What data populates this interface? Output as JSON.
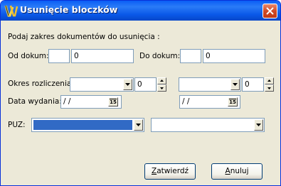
{
  "window": {
    "title": "Usunięcie bloczków",
    "app_icon": "app-logo-icon",
    "close_icon": "close-icon"
  },
  "form": {
    "instruction": "Podaj zakres dokumentów do usunięcia :",
    "from_label": "Od dokum:",
    "from_prefix_value": "",
    "from_number_value": "0",
    "to_label": "Do dokum:",
    "to_prefix_value": "",
    "to_number_value": "0",
    "period_label": "Okres rozliczenia:",
    "period_left_value": "",
    "period_left_spin_value": "0",
    "period_right_value": "",
    "period_right_spin_value": "0",
    "issue_label": "Data wydania:",
    "issue_date_left": " / /",
    "issue_date_right": " / /",
    "calendar_label": "15",
    "puz_label": "PUZ:",
    "puz_left_value": "",
    "puz_right_value": ""
  },
  "buttons": {
    "confirm_first": "Z",
    "confirm_rest": "atwierdź",
    "cancel_first": "A",
    "cancel_rest": "nuluj"
  }
}
